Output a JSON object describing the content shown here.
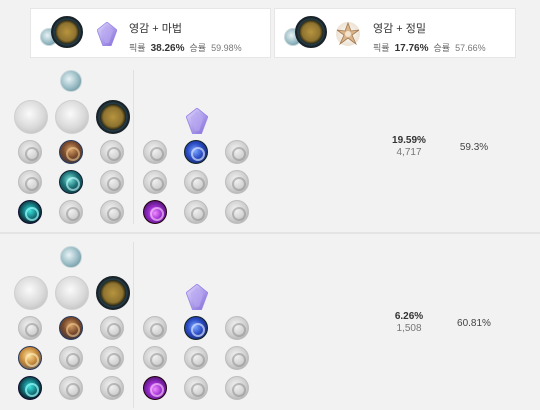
{
  "summary_cards": [
    {
      "title": "영감 + 마법",
      "pick_label": "픽률",
      "pick_value": "38.26%",
      "win_label": "승률",
      "win_value": "59.98%"
    },
    {
      "title": "영감 + 정밀",
      "pick_label": "픽률",
      "pick_value": "17.76%",
      "win_label": "승률",
      "win_value": "57.66%"
    }
  ],
  "builds": [
    {
      "pick_rate": "19.59%",
      "games": "4,717",
      "win_rate": "59.3%"
    },
    {
      "pick_rate": "6.26%",
      "games": "1,508",
      "win_rate": "60.81%"
    }
  ],
  "icons": {
    "inspiration": "inspiration-tree-icon",
    "sorcery": "sorcery-tree-icon",
    "precision": "precision-tree-icon",
    "keystone": "keystone-rune-icon"
  },
  "colors": {
    "background": "#f2f2f2",
    "card": "#ffffff",
    "text": "#333333"
  }
}
